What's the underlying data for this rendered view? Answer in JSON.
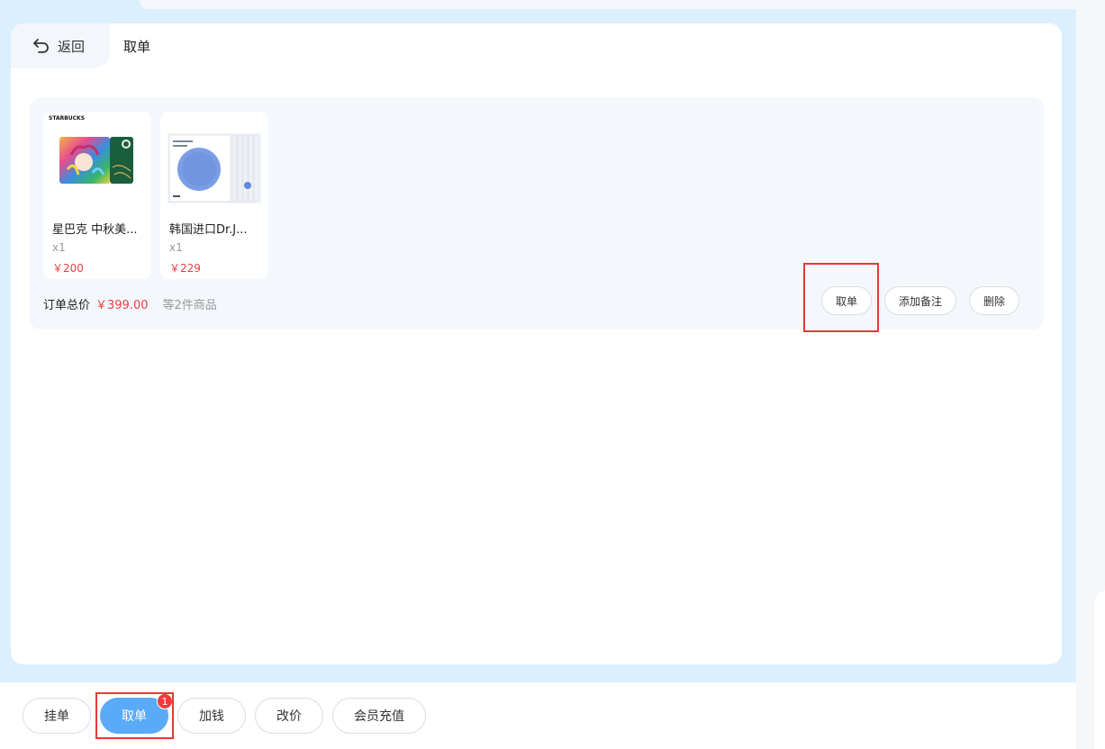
{
  "header": {
    "back_label": "返回",
    "title": "取单"
  },
  "order": {
    "products": [
      {
        "name": "星巴克 中秋美...",
        "qty": "x1",
        "price": "￥200",
        "brand_text": "STARBUCKS"
      },
      {
        "name": "韩国进口Dr.J...",
        "qty": "x1",
        "price": "￥229"
      }
    ],
    "total_label": "订单总价",
    "total_value": "￥399.00",
    "total_count": "等2件商品",
    "actions": {
      "take": "取单",
      "note": "添加备注",
      "delete": "删除"
    }
  },
  "bottom_bar": {
    "buttons": [
      {
        "label": "挂单"
      },
      {
        "label": "取单",
        "badge": "1",
        "active": true
      },
      {
        "label": "加钱"
      },
      {
        "label": "改价"
      },
      {
        "label": "会员充值"
      }
    ]
  },
  "colors": {
    "accent": "#5aaaf8",
    "price": "#e84141",
    "highlight": "#e53935",
    "page_bg": "#dcefff"
  }
}
